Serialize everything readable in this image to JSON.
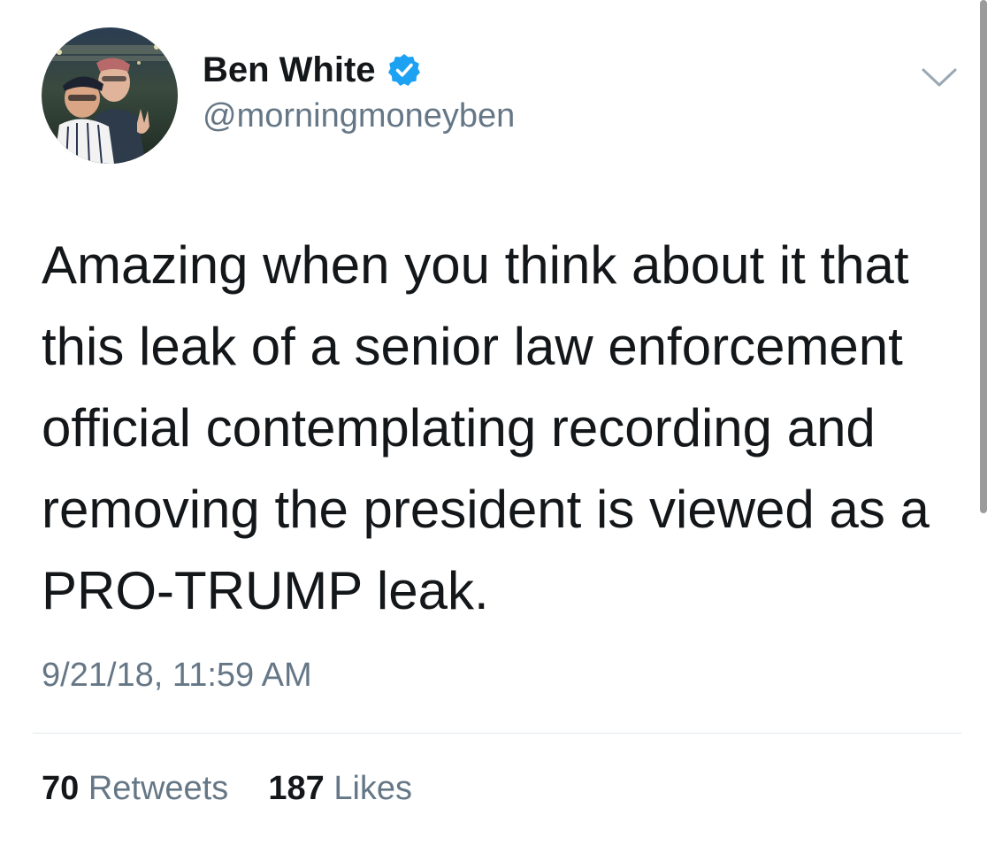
{
  "author": {
    "display_name": "Ben White",
    "handle": "@morningmoneyben",
    "verified": true,
    "avatar_icon": "profile-photo"
  },
  "tweet": {
    "lines": [
      "Amazing when you think about it that",
      "this leak of a senior law enforcement",
      "official contemplating recording and",
      "removing the president is viewed as a",
      "PRO-TRUMP leak."
    ],
    "timestamp": "9/21/18, 11:59 AM"
  },
  "stats": {
    "retweets_count": "70",
    "retweets_label": "Retweets",
    "likes_count": "187",
    "likes_label": "Likes"
  },
  "icons": {
    "verified": "verified-badge-icon",
    "menu": "chevron-down-icon"
  },
  "colors": {
    "verified_blue": "#1da1f2",
    "primary_text": "#14171a",
    "secondary_text": "#657786",
    "divider": "#e1e8ed"
  }
}
